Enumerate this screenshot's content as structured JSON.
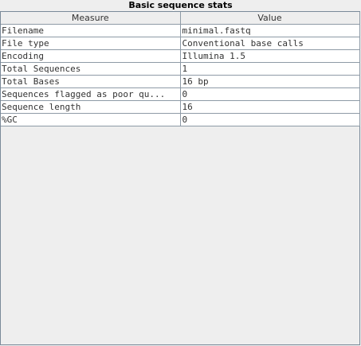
{
  "title": "Basic sequence stats",
  "table": {
    "headers": [
      "Measure",
      "Value"
    ],
    "rows": [
      {
        "measure": "Filename",
        "value": "minimal.fastq"
      },
      {
        "measure": "File type",
        "value": "Conventional base calls"
      },
      {
        "measure": "Encoding",
        "value": "Illumina 1.5"
      },
      {
        "measure": "Total Sequences",
        "value": "1"
      },
      {
        "measure": "Total Bases",
        "value": "16 bp"
      },
      {
        "measure": "Sequences flagged as poor qu...",
        "value": "0"
      },
      {
        "measure": "Sequence length",
        "value": "16"
      },
      {
        "measure": "%GC",
        "value": "0"
      }
    ]
  }
}
